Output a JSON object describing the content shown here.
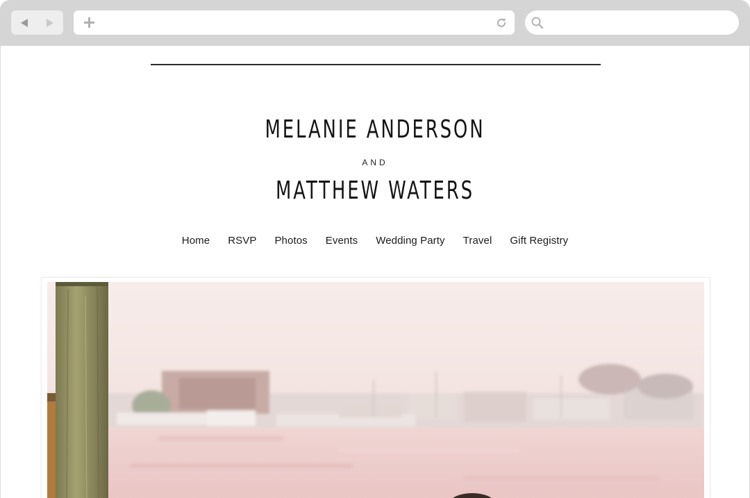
{
  "browser": {
    "back_icon": "back-arrow-icon",
    "forward_icon": "forward-arrow-icon",
    "new_tab_icon": "plus-icon",
    "reload_icon": "reload-icon",
    "search_icon": "search-icon",
    "address_value": "",
    "search_value": ""
  },
  "site": {
    "name_1": "MELANIE ANDERSON",
    "connector": "AND",
    "name_2": "MATTHEW WATERS"
  },
  "nav": {
    "items": [
      "Home",
      "RSVP",
      "Photos",
      "Events",
      "Wedding Party",
      "Travel",
      "Gift Registry"
    ]
  },
  "hero": {
    "description_icon": "harbor-photo"
  },
  "colors": {
    "chrome": "#d5d5d5",
    "text": "#151515",
    "sky": "#f6e9e6",
    "water": "#f1d3d1"
  }
}
